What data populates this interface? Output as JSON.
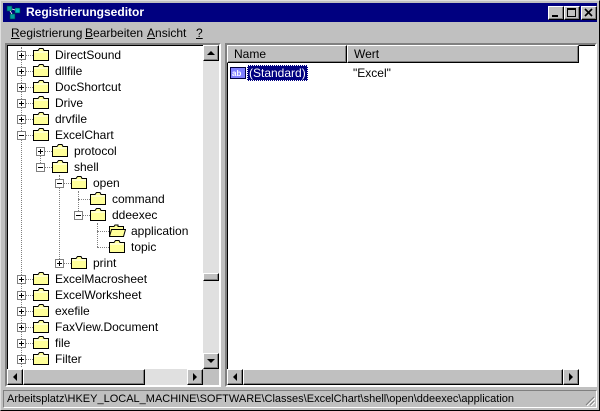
{
  "window": {
    "title": "Registrierungseditor",
    "app_icon": "regedit-icon",
    "controls": [
      "minimize-icon",
      "maximize-icon",
      "close-icon"
    ]
  },
  "menu": [
    {
      "label": "Registrierung",
      "underline": "R",
      "rest": "egistrierung"
    },
    {
      "label": "Bearbeiten",
      "underline": "B",
      "rest": "earbeiten"
    },
    {
      "label": "Ansicht",
      "underline": "A",
      "rest": "nsicht"
    },
    {
      "label": "?",
      "underline": "?",
      "rest": ""
    }
  ],
  "tree": {
    "nodes": [
      {
        "label": "DirectSound",
        "expander": "plus",
        "selected": false
      },
      {
        "label": "dllfile",
        "expander": "plus",
        "selected": false
      },
      {
        "label": "DocShortcut",
        "expander": "plus",
        "selected": false
      },
      {
        "label": "Drive",
        "expander": "plus",
        "selected": false
      },
      {
        "label": "drvfile",
        "expander": "plus",
        "selected": false
      },
      {
        "label": "ExcelChart",
        "expander": "minus",
        "selected": false
      },
      {
        "label": "protocol",
        "expander": "plus",
        "selected": false
      },
      {
        "label": "shell",
        "expander": "minus",
        "selected": false
      },
      {
        "label": "open",
        "expander": "minus",
        "selected": false
      },
      {
        "label": "command",
        "expander": "none",
        "selected": false
      },
      {
        "label": "ddeexec",
        "expander": "minus",
        "selected": false
      },
      {
        "label": "application",
        "expander": "none",
        "selected": true
      },
      {
        "label": "topic",
        "expander": "none",
        "selected": false
      },
      {
        "label": "print",
        "expander": "plus",
        "selected": false
      },
      {
        "label": "ExcelMacrosheet",
        "expander": "plus",
        "selected": false
      },
      {
        "label": "ExcelWorksheet",
        "expander": "plus",
        "selected": false
      },
      {
        "label": "exefile",
        "expander": "plus",
        "selected": false
      },
      {
        "label": "FaxView.Document",
        "expander": "plus",
        "selected": false
      },
      {
        "label": "file",
        "expander": "plus",
        "selected": false
      },
      {
        "label": "Filter",
        "expander": "plus",
        "selected": false
      }
    ]
  },
  "list": {
    "columns": [
      "Name",
      "Wert"
    ],
    "rows": [
      {
        "name": "(Standard)",
        "value": "\"Excel\"",
        "icon": "string-value-icon"
      }
    ]
  },
  "status": {
    "path": "Arbeitsplatz\\HKEY_LOCAL_MACHINE\\SOFTWARE\\Classes\\ExcelChart\\shell\\open\\ddeexec\\application"
  },
  "colors": {
    "title_bar": "#000080",
    "selection": "#000080",
    "folder": "#ffff99",
    "face": "#c0c0c0"
  }
}
